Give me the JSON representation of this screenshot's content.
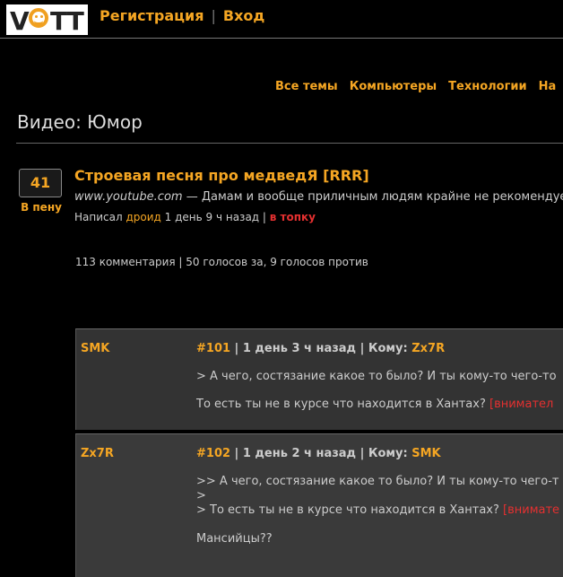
{
  "logo": {
    "text_v": "V",
    "text_tt": "TT"
  },
  "auth": {
    "register": "Регистрация",
    "separator": "|",
    "login": "Вход"
  },
  "nav": [
    "Все темы",
    "Компьютеры",
    "Технологии",
    "На"
  ],
  "page_title": "Видео: Юмор",
  "post": {
    "votes": "41",
    "vote_label": "В пену",
    "title": "Строевая песня про медведЯ [RRR]",
    "domain": "www.youtube.com",
    "desc": " — Дамам и вообще приличным людям крайне не рекомендуе",
    "meta_prefix": "Написал ",
    "author": "дроид",
    "meta_time": " 1 день 9 ч назад | ",
    "to_top": "в топку",
    "stats": "113 комментария | 50 голосов за, 9 голосов против"
  },
  "comments": [
    {
      "author": "SMK",
      "num": "#101",
      "time": " | 1 день 3 ч назад | Кому: ",
      "to": "Zx7R",
      "line1": "> А чего, состязание какое то было? И ты кому-то чего-то",
      "line2_text": "То есть ты не в курсе что находится в Хантах? ",
      "line2_warn": "[внимател"
    },
    {
      "author": "Zx7R",
      "num": "#102",
      "time": " | 1 день 2 ч назад | Кому: ",
      "to": "SMK",
      "line1": ">> А чего, состязание какое то было? И ты кому-то чего-т",
      "line2": ">",
      "line3_text": "> То есть ты не в курсе что находится в Хантах? ",
      "line3_warn": "[внимате",
      "line4": "Мансийцы??"
    }
  ],
  "colors": {
    "accent": "#f5a623",
    "warning": "#e53030",
    "background": "#000000"
  }
}
